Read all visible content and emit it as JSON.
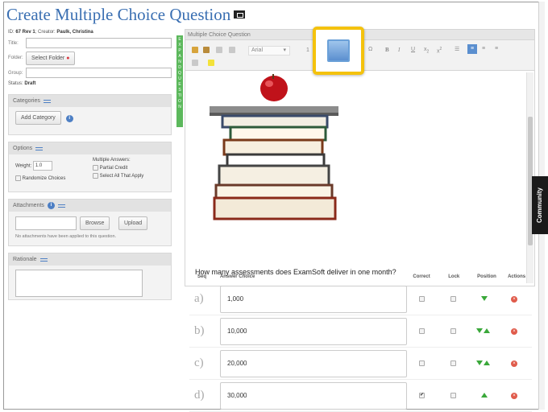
{
  "page": {
    "title": "Create Multiple Choice Question"
  },
  "meta": {
    "id_label": "ID:",
    "id_value": "67 Rev 1",
    "creator_label": "; Creator:",
    "creator_value": "Paulk, Christina",
    "title_label": "Title:",
    "folder_label": "Folder:",
    "select_folder": "Select Folder",
    "group_label": "Group:",
    "status_label": "Status:",
    "status_value": "Draft"
  },
  "categories": {
    "heading": "Categories",
    "add_button": "Add Category"
  },
  "options": {
    "heading": "Options",
    "weight_label": "Weight:",
    "weight_value": "1.0",
    "randomize_label": "Randomize Choices",
    "multiple_answers_label": "Multiple Answers:",
    "partial_credit_label": "Partial Credit",
    "select_all_label": "Select All That Apply"
  },
  "attachments": {
    "heading": "Attachments",
    "browse_button": "Browse",
    "upload_button": "Upload",
    "note": "No attachments have been applied to this question."
  },
  "rationale": {
    "heading": "Rationale"
  },
  "expand_strip": "EXPAND QUESTION",
  "editor": {
    "heading": "Multiple Choice Question",
    "font_name": "Arial",
    "font_size": "1",
    "question_text": "How many assessments does ExamSoft deliver in one month?"
  },
  "answers": {
    "headers": {
      "seq": "Seq",
      "choice": "Answer Choice",
      "correct": "Correct",
      "lock": "Lock",
      "position": "Position",
      "actions": "Actions"
    },
    "rows": [
      {
        "seq": "a)",
        "choice": "1,000",
        "correct": false
      },
      {
        "seq": "b)",
        "choice": "10,000",
        "correct": false
      },
      {
        "seq": "c)",
        "choice": "20,000",
        "correct": false
      },
      {
        "seq": "d)",
        "choice": "30,000",
        "correct": true
      }
    ]
  },
  "community": "Community",
  "colors": {
    "title_blue": "#3a6fb2",
    "highlight_yellow": "#f4c20d",
    "expand_green": "#5cb85c",
    "arrow_green": "#3aa83a",
    "delete_red": "#e05b4b"
  }
}
